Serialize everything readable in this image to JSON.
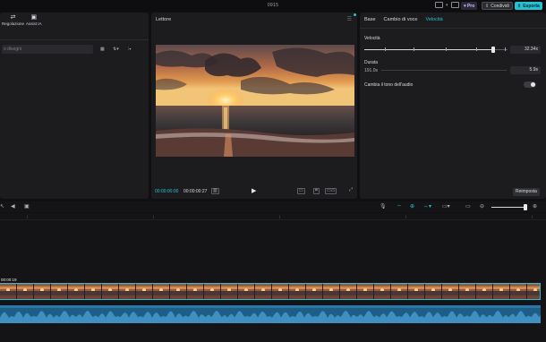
{
  "titlebar": {
    "title": "0915",
    "pro_label": "Pro",
    "share_label": "Condividi",
    "export_label": "Esporta"
  },
  "left_panel": {
    "tools": [
      {
        "label": "Regolazione",
        "icon": "sliders-icon"
      },
      {
        "label": "Assist IA",
        "icon": "ai-assist-icon"
      }
    ],
    "search_placeholder": "o disegni"
  },
  "player": {
    "title": "Lettore",
    "current_time": "00:00:00:00",
    "duration": "00:00:00:27"
  },
  "properties": {
    "tabs": [
      "Base",
      "Cambio di voce",
      "Velocità"
    ],
    "active_tab": "Velocità",
    "speed_label": "Velocità",
    "speed_value": "32.34x",
    "speed_fraction": 0.9,
    "duration_label": "Durata",
    "duration_from": "191.0s",
    "duration_to": "5.9s",
    "pitch_label": "Cambia il tono dell'audio",
    "pitch_toggle_on": false,
    "reset_label": "Reimposta"
  },
  "timeline": {
    "clip_timecode": "00:00:19",
    "zoom_fraction": 0.95
  },
  "colors": {
    "accent": "#25c0d4",
    "panel": "#1c1c1f",
    "audio": "#1e5d86"
  }
}
